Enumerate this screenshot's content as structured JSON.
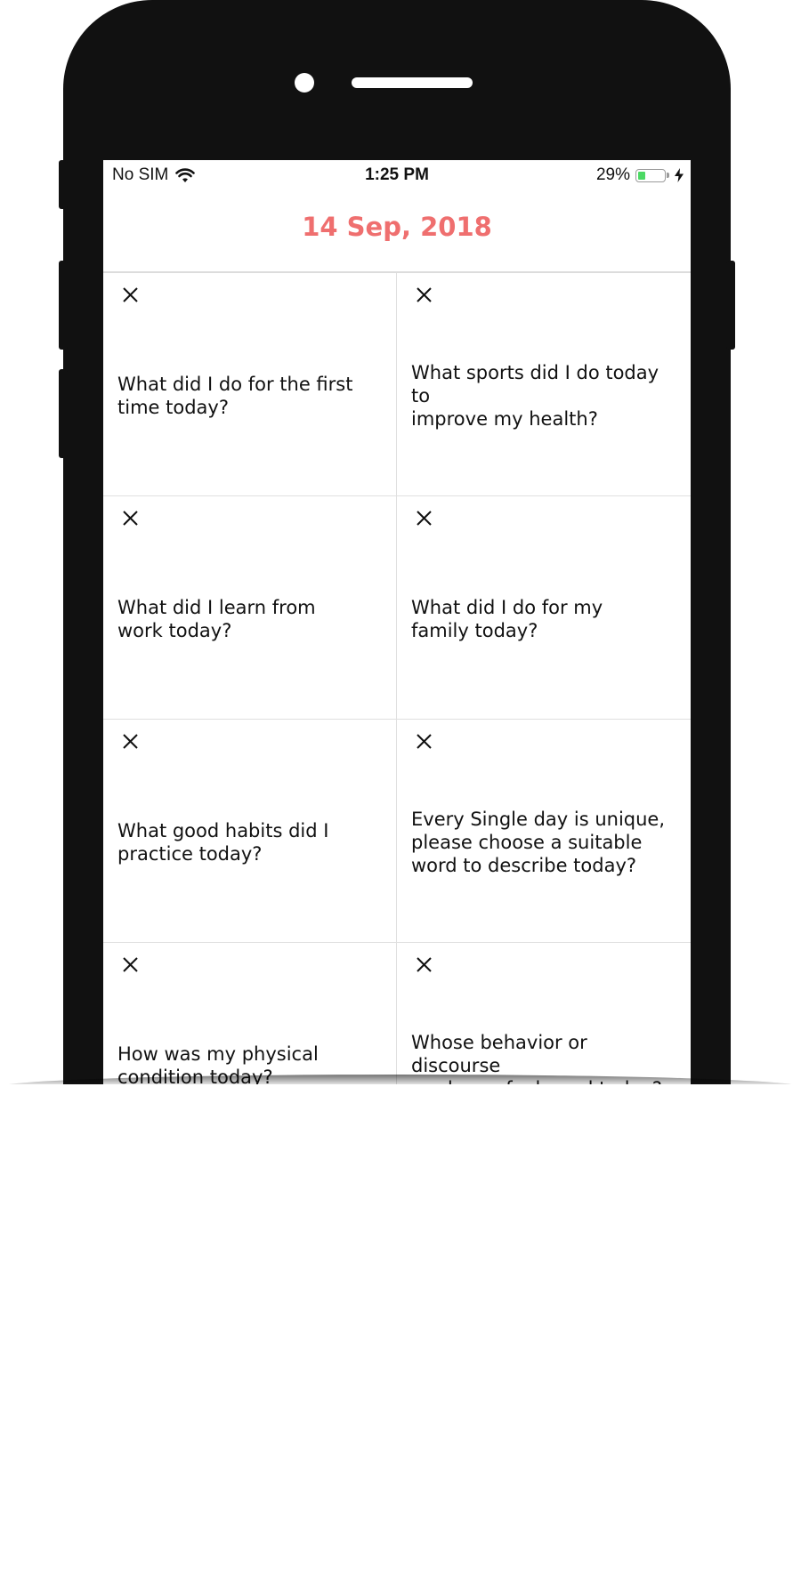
{
  "status_bar": {
    "carrier": "No SIM",
    "time": "1:25 PM",
    "battery_percent": "29%",
    "battery_level": 0.29,
    "icons": [
      "wifi-icon",
      "battery-icon",
      "charging-bolt-icon"
    ]
  },
  "header": {
    "date": "14 Sep, 2018",
    "accent_color": "#ef6f6f"
  },
  "cards": [
    {
      "text": "What did I do for the first\ntime  today?"
    },
    {
      "text": "What sports did I do today to\nimprove my health?"
    },
    {
      "text": "What did I learn from\nwork today?"
    },
    {
      "text": "What did I do for my\nfamily today?"
    },
    {
      "text": "What good habits did I\npractice today?"
    },
    {
      "text": "Every Single day is unique,\nplease choose a suitable\nword to describe today?"
    },
    {
      "text": "How was my physical\ncondition today?"
    },
    {
      "text": "Whose behavior or discourse\nmade me feel good today?"
    }
  ],
  "card_close_icon": "close-icon"
}
